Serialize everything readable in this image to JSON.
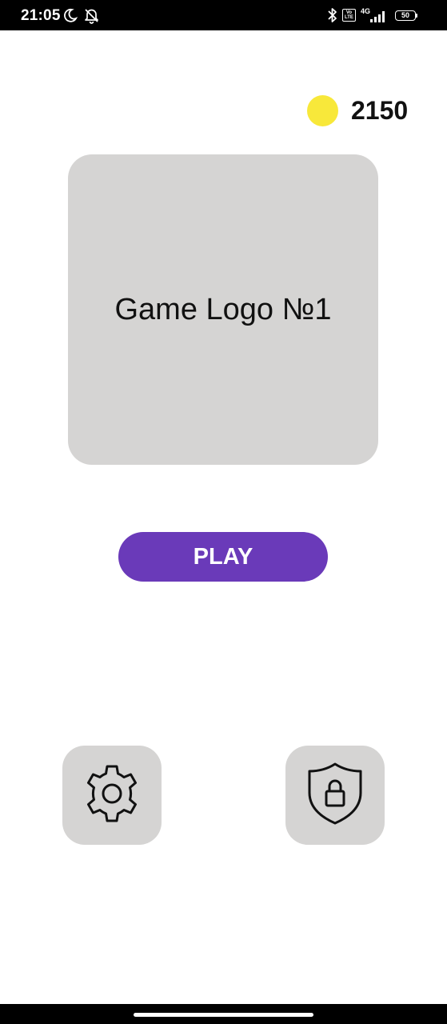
{
  "status_bar": {
    "time": "21:05",
    "network_label": "4G",
    "volte_label": "Vo LTE",
    "battery_level": "50",
    "icons": [
      "moon-icon",
      "notifications-off-icon",
      "bluetooth-icon",
      "volte-icon",
      "signal-icon",
      "battery-icon"
    ]
  },
  "coins": {
    "count": "2150",
    "icon": "coin-icon",
    "color": "#f8e83a"
  },
  "logo": {
    "text": "Game Logo №1",
    "background": "#d5d4d3"
  },
  "play_button": {
    "label": "PLAY",
    "color": "#6a3ab9"
  },
  "bottom_buttons": {
    "settings_icon": "gear-icon",
    "privacy_icon": "shield-lock-icon",
    "background": "#d5d4d3"
  }
}
